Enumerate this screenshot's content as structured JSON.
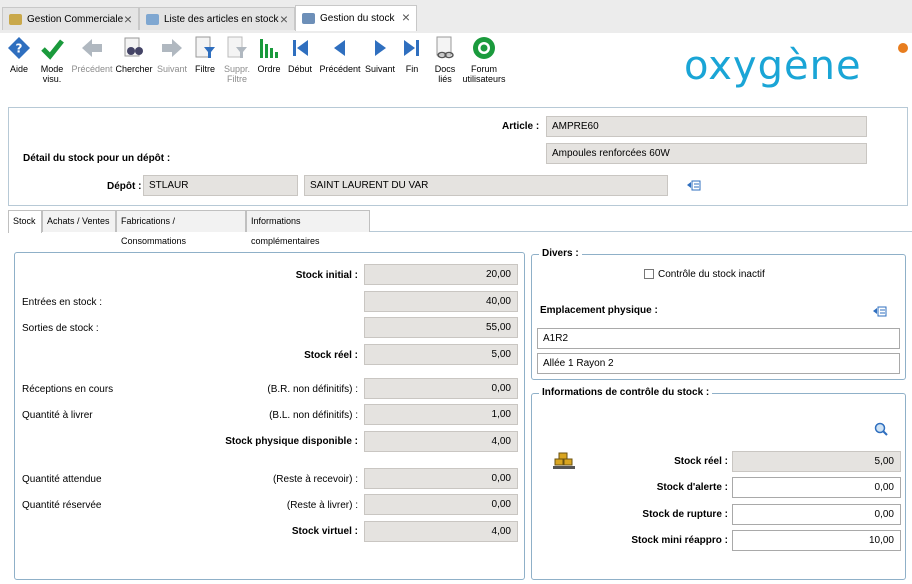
{
  "tabs_bar": {
    "tabs": [
      {
        "label": "Gestion Commerciale"
      },
      {
        "label": "Liste des articles en stock"
      },
      {
        "label": "Gestion du stock"
      }
    ]
  },
  "toolbar": {
    "aide": "Aide",
    "mode_visu_1": "Mode",
    "mode_visu_2": "visu.",
    "precedent": "Précédent",
    "chercher": "Chercher",
    "suivant": "Suivant",
    "filtre": "Filtre",
    "suppr_filtre_1": "Suppr.",
    "suppr_filtre_2": "Filtre",
    "ordre": "Ordre",
    "debut": "Début",
    "precedent2": "Précédent",
    "suivant2": "Suivant",
    "fin": "Fin",
    "docs_1": "Docs",
    "docs_2": "liés",
    "forum_1": "Forum",
    "forum_2": "utilisateurs",
    "logo": "oxygène"
  },
  "header": {
    "article_label": "Article :",
    "article_code": "AMPRE60",
    "article_name": "Ampoules renforcées 60W",
    "detail_label": "Détail du stock pour un dépôt :",
    "depot_label": "Dépôt :",
    "depot_code": "STLAUR",
    "depot_name": "SAINT LAURENT DU VAR"
  },
  "content_tabs": [
    {
      "label": "Stock"
    },
    {
      "label": "Achats / Ventes"
    },
    {
      "label": "Fabrications / Consommations"
    },
    {
      "label": "Informations complémentaires"
    }
  ],
  "stock": {
    "stock_initial_label": "Stock initial :",
    "stock_initial": "20,00",
    "entrees_label": "Entrées en stock :",
    "entrees": "40,00",
    "sorties_label": "Sorties de stock :",
    "sorties": "55,00",
    "stock_reel_label": "Stock réel :",
    "stock_reel": "5,00",
    "receptions_label": "Réceptions en cours",
    "receptions_sub": "(B.R. non définitifs) :",
    "receptions": "0,00",
    "qte_livrer_label": "Quantité à livrer",
    "qte_livrer_sub": "(B.L. non définitifs) :",
    "qte_livrer": "1,00",
    "stock_physique_label": "Stock physique disponible :",
    "stock_physique": "4,00",
    "qte_attendue_label": "Quantité attendue",
    "qte_attendue_sub": "(Reste à recevoir) :",
    "qte_attendue": "0,00",
    "qte_reservee_label": "Quantité réservée",
    "qte_reservee_sub": "(Reste à livrer) :",
    "qte_reservee": "0,00",
    "stock_virtuel_label": "Stock virtuel :",
    "stock_virtuel": "4,00"
  },
  "divers": {
    "title": "Divers :",
    "controle_inactif": "Contrôle du stock inactif",
    "emplacement_label": "Emplacement physique :",
    "emplacement_1": "A1R2",
    "emplacement_2": "Allée 1 Rayon 2"
  },
  "controle": {
    "title": "Informations de contrôle du stock :",
    "stock_reel_label": "Stock réel :",
    "stock_reel": "5,00",
    "alerte_label": "Stock d'alerte :",
    "alerte": "0,00",
    "rupture_label": "Stock de rupture :",
    "rupture": "0,00",
    "mini_label": "Stock mini réappro :",
    "mini": "10,00"
  },
  "colors": {
    "accent": "#1aa5d6",
    "nav_blue": "#2f6fbf",
    "green": "#1a9a3c"
  }
}
